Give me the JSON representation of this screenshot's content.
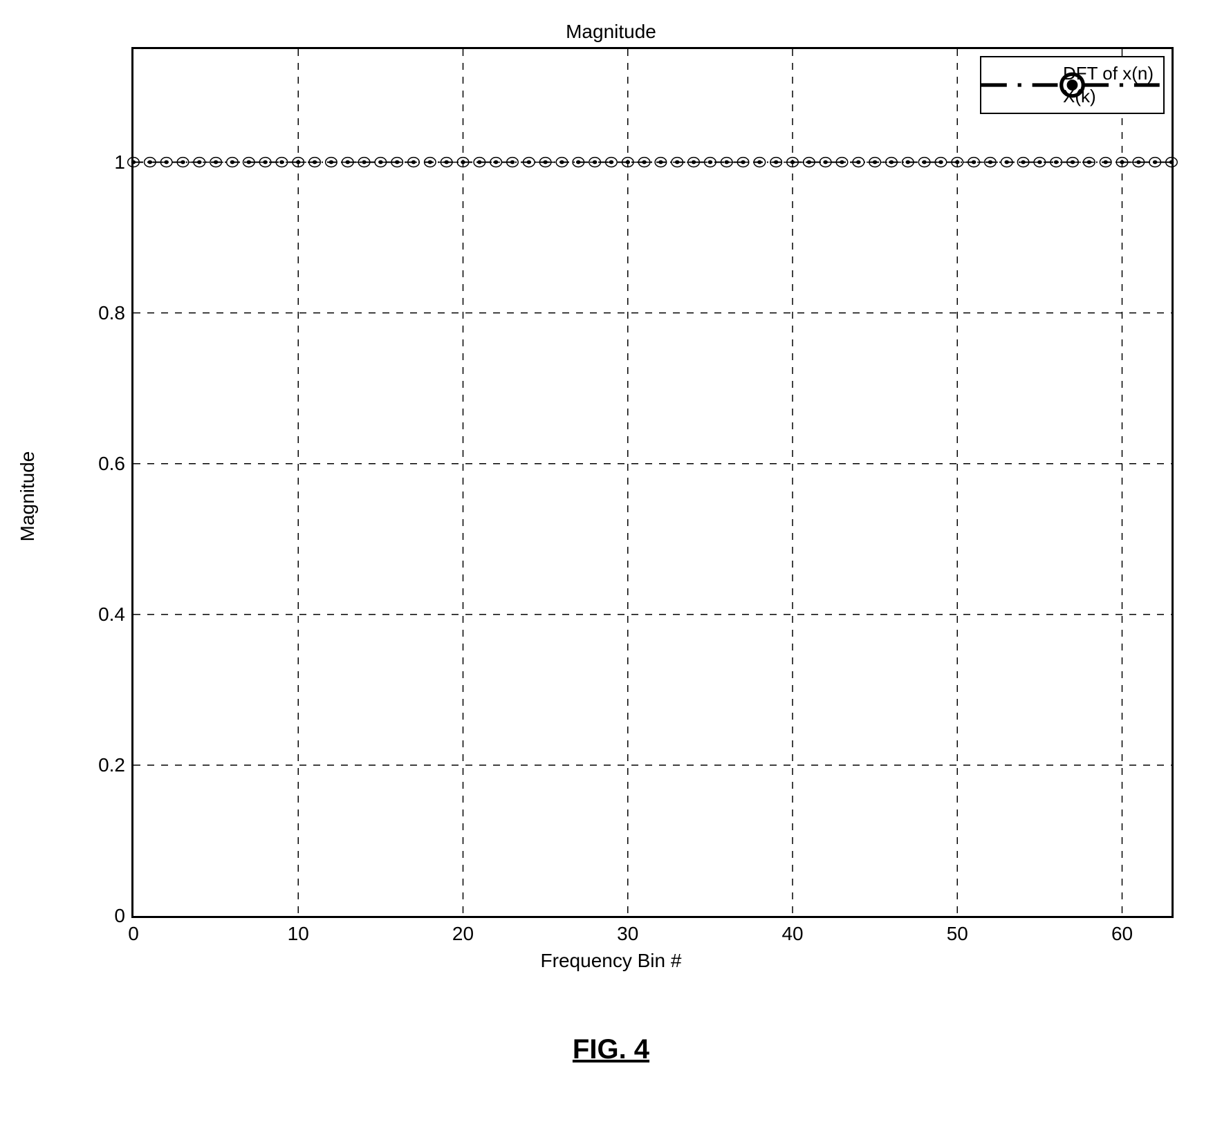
{
  "chart_data": {
    "type": "line",
    "title": "Magnitude",
    "xlabel": "Frequency Bin #",
    "ylabel": "Magnitude",
    "xlim": [
      0,
      63
    ],
    "ylim": [
      0,
      1.15
    ],
    "xticks": [
      0,
      10,
      20,
      30,
      40,
      50,
      60
    ],
    "yticks": [
      0,
      0.2,
      0.4,
      0.6,
      0.8,
      1
    ],
    "series": [
      {
        "name": "DFT of x(n)",
        "marker": "dot",
        "line": "dash-dot",
        "x": [
          0,
          1,
          2,
          3,
          4,
          5,
          6,
          7,
          8,
          9,
          10,
          11,
          12,
          13,
          14,
          15,
          16,
          17,
          18,
          19,
          20,
          21,
          22,
          23,
          24,
          25,
          26,
          27,
          28,
          29,
          30,
          31,
          32,
          33,
          34,
          35,
          36,
          37,
          38,
          39,
          40,
          41,
          42,
          43,
          44,
          45,
          46,
          47,
          48,
          49,
          50,
          51,
          52,
          53,
          54,
          55,
          56,
          57,
          58,
          59,
          60,
          61,
          62,
          63
        ],
        "values": [
          1,
          1,
          1,
          1,
          1,
          1,
          1,
          1,
          1,
          1,
          1,
          1,
          1,
          1,
          1,
          1,
          1,
          1,
          1,
          1,
          1,
          1,
          1,
          1,
          1,
          1,
          1,
          1,
          1,
          1,
          1,
          1,
          1,
          1,
          1,
          1,
          1,
          1,
          1,
          1,
          1,
          1,
          1,
          1,
          1,
          1,
          1,
          1,
          1,
          1,
          1,
          1,
          1,
          1,
          1,
          1,
          1,
          1,
          1,
          1,
          1,
          1,
          1,
          1
        ]
      },
      {
        "name": "X(k)",
        "marker": "circle",
        "line": "none",
        "x": [
          0,
          1,
          2,
          3,
          4,
          5,
          6,
          7,
          8,
          9,
          10,
          11,
          12,
          13,
          14,
          15,
          16,
          17,
          18,
          19,
          20,
          21,
          22,
          23,
          24,
          25,
          26,
          27,
          28,
          29,
          30,
          31,
          32,
          33,
          34,
          35,
          36,
          37,
          38,
          39,
          40,
          41,
          42,
          43,
          44,
          45,
          46,
          47,
          48,
          49,
          50,
          51,
          52,
          53,
          54,
          55,
          56,
          57,
          58,
          59,
          60,
          61,
          62,
          63
        ],
        "values": [
          1,
          1,
          1,
          1,
          1,
          1,
          1,
          1,
          1,
          1,
          1,
          1,
          1,
          1,
          1,
          1,
          1,
          1,
          1,
          1,
          1,
          1,
          1,
          1,
          1,
          1,
          1,
          1,
          1,
          1,
          1,
          1,
          1,
          1,
          1,
          1,
          1,
          1,
          1,
          1,
          1,
          1,
          1,
          1,
          1,
          1,
          1,
          1,
          1,
          1,
          1,
          1,
          1,
          1,
          1,
          1,
          1,
          1,
          1,
          1,
          1,
          1,
          1,
          1
        ]
      }
    ],
    "grid": {
      "x": true,
      "y": true,
      "style": "dashed"
    },
    "legend_position": "upper right"
  },
  "caption": "FIG. 4"
}
